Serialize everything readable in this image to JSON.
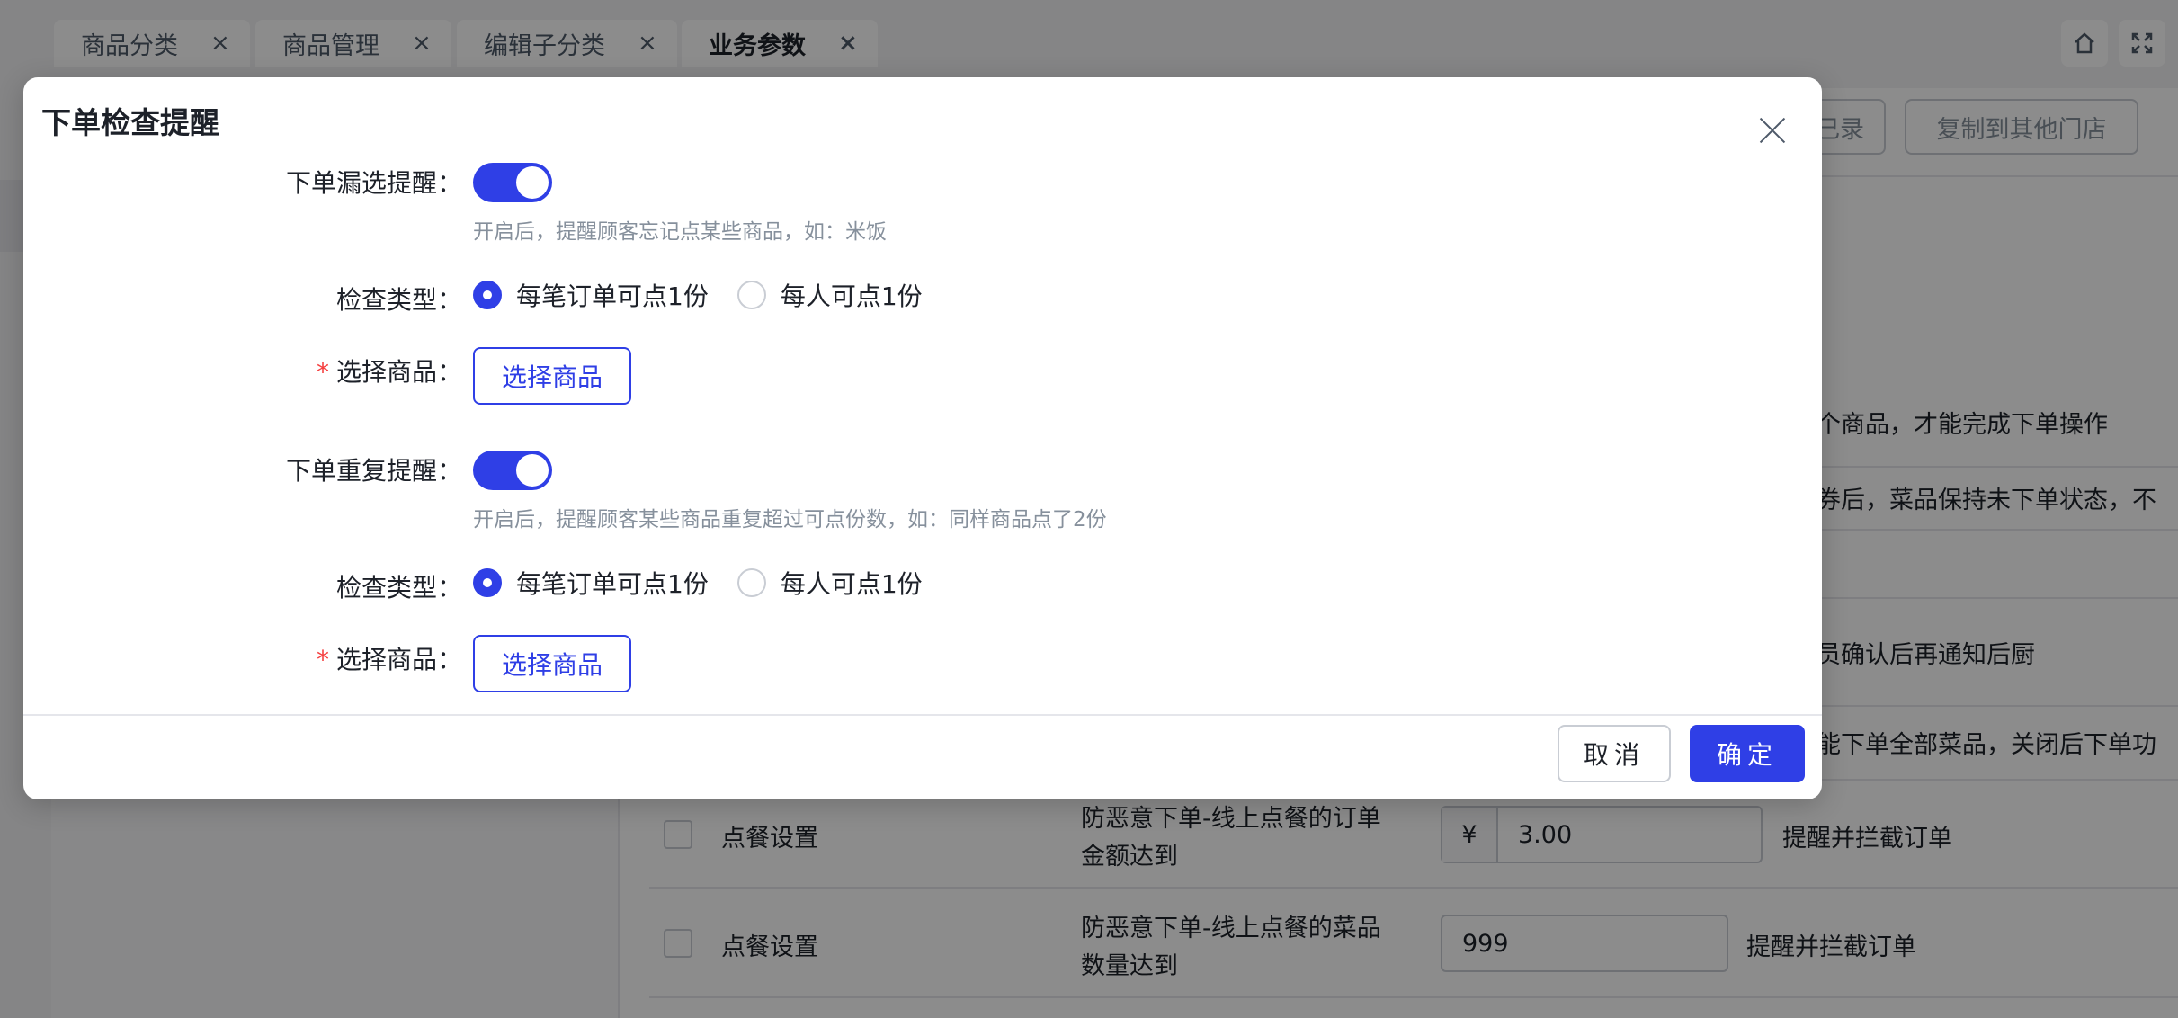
{
  "tabs": [
    {
      "label": "商品分类",
      "active": false
    },
    {
      "label": "商品管理",
      "active": false
    },
    {
      "label": "编辑子分类",
      "active": false
    },
    {
      "label": "业务参数",
      "active": true
    }
  ],
  "tab_close_glyph": "×",
  "toolbar": {
    "icons": [
      "home-icon",
      "fullscreen-icon"
    ]
  },
  "header": {
    "record_button_partial": "己录",
    "copy_button": "复制到其他门店"
  },
  "background_rows_partial": [
    "个商品，才能完成下单操作",
    "券后，菜品保持未下单状态，不",
    "员确认后再通知后厨",
    "能下单全部菜品，关闭后下单功"
  ],
  "table_rows": [
    {
      "category": "点餐设置",
      "desc_line1": "防恶意下单-线上点餐的订单",
      "desc_line2": "金额达到",
      "prefix": "¥",
      "value": "3.00",
      "action": "提醒并拦截订单"
    },
    {
      "category": "点餐设置",
      "desc_line1": "防恶意下单-线上点餐的菜品",
      "desc_line2": "数量达到",
      "value": "999",
      "action": "提醒并拦截订单"
    }
  ],
  "modal": {
    "title": "下单检查提醒",
    "missing": {
      "label": "下单漏选提醒：",
      "enabled": true,
      "hint": "开启后，提醒顾客忘记点某些商品，如：米饭",
      "check_type_label": "检查类型：",
      "options": [
        "每笔订单可点1份",
        "每人可点1份"
      ],
      "selected": 0,
      "select_label": "选择商品：",
      "required_mark": "*",
      "select_button": "选择商品"
    },
    "repeat": {
      "label": "下单重复提醒：",
      "enabled": true,
      "hint": "开启后，提醒顾客某些商品重复超过可点份数，如：同样商品点了2份",
      "check_type_label": "检查类型：",
      "options": [
        "每笔订单可点1份",
        "每人可点1份"
      ],
      "selected": 0,
      "select_label": "选择商品：",
      "required_mark": "*",
      "select_button": "选择商品"
    },
    "cancel_button": "取消",
    "ok_button": "确定"
  },
  "colors": {
    "primary": "#2f3fe6",
    "danger": "#f53f3f",
    "mask": "rgba(0,0,0,0.45)"
  }
}
